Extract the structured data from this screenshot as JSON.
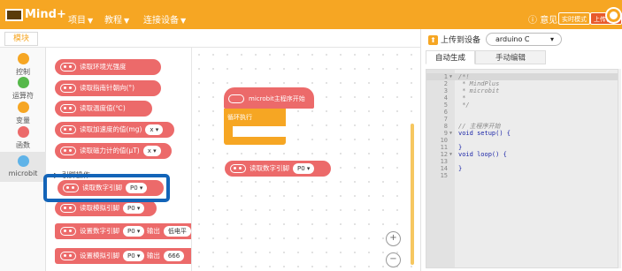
{
  "topbar": {
    "logo": "Mind+",
    "menu": [
      {
        "label": "项目"
      },
      {
        "label": "教程"
      },
      {
        "label": "连接设备"
      }
    ],
    "feedback": "意见反馈",
    "mode_realtime": "实时模式",
    "mode_upload": "上传模式"
  },
  "tabs": {
    "blocks": "模块"
  },
  "categories": [
    {
      "label": "控制",
      "color": "#f6a623"
    },
    {
      "label": "运算符",
      "color": "#56b84a"
    },
    {
      "label": "变量",
      "color": "#f6a623"
    },
    {
      "label": "函数",
      "color": "#ec6a6a"
    },
    {
      "label": "microbit",
      "color": "#5fb3e8"
    }
  ],
  "flyout": {
    "blocks": [
      {
        "label": "读取环境光强度"
      },
      {
        "label": "读取指南针朝向(°)"
      },
      {
        "label": "读取温度值(℃)"
      },
      {
        "label": "读取加速度的值(mg)",
        "dropdown": "x"
      },
      {
        "label": "读取磁力计的值(μT)",
        "dropdown": "x"
      }
    ],
    "section_label": "引脚操作",
    "pin_blocks": [
      {
        "label": "读取数字引脚",
        "dropdown": "P0"
      },
      {
        "label": "读取模拟引脚",
        "dropdown": "P0"
      },
      {
        "label": "设置数字引脚",
        "dropdown": "P0",
        "suffix": "输出",
        "value": "低电平"
      },
      {
        "label": "设置模拟引脚",
        "dropdown": "P0",
        "suffix": "输出",
        "value": "666"
      }
    ]
  },
  "workspace": {
    "hat_label": "microbit主程序开始",
    "loop_label": "循环执行",
    "loose_block": {
      "label": "读取数字引脚",
      "dropdown": "P0"
    },
    "zoom_in": "+",
    "zoom_out": "−"
  },
  "right_panel": {
    "upload_label": "上传到设备",
    "device": "arduino C",
    "tab_auto": "自动生成",
    "tab_manual": "手动编辑",
    "code_lines": [
      {
        "n": "1",
        "text": "/*!",
        "cls": "c-comment",
        "fold": true
      },
      {
        "n": "2",
        "text": " * MindPlus",
        "cls": "c-comment"
      },
      {
        "n": "3",
        "text": " * microbit",
        "cls": "c-comment"
      },
      {
        "n": "4",
        "text": " *",
        "cls": "c-comment"
      },
      {
        "n": "5",
        "text": " */",
        "cls": "c-comment"
      },
      {
        "n": "6",
        "text": "",
        "cls": "c-default"
      },
      {
        "n": "7",
        "text": "",
        "cls": "c-default"
      },
      {
        "n": "8",
        "text": "// 主程序开始",
        "cls": "c-comment"
      },
      {
        "n": "9",
        "text": "void setup() {",
        "cls": "c-kw",
        "fold": true
      },
      {
        "n": "10",
        "text": "",
        "cls": "c-default"
      },
      {
        "n": "11",
        "text": "}",
        "cls": "c-kw"
      },
      {
        "n": "12",
        "text": "void loop() {",
        "cls": "c-kw",
        "fold": true
      },
      {
        "n": "13",
        "text": "",
        "cls": "c-default"
      },
      {
        "n": "14",
        "text": "}",
        "cls": "c-kw"
      },
      {
        "n": "15",
        "text": "",
        "cls": "c-default"
      }
    ]
  },
  "colors": {
    "brand": "#f6a623",
    "microbit_block": "#ec6a6a",
    "highlight": "#1364b8"
  }
}
